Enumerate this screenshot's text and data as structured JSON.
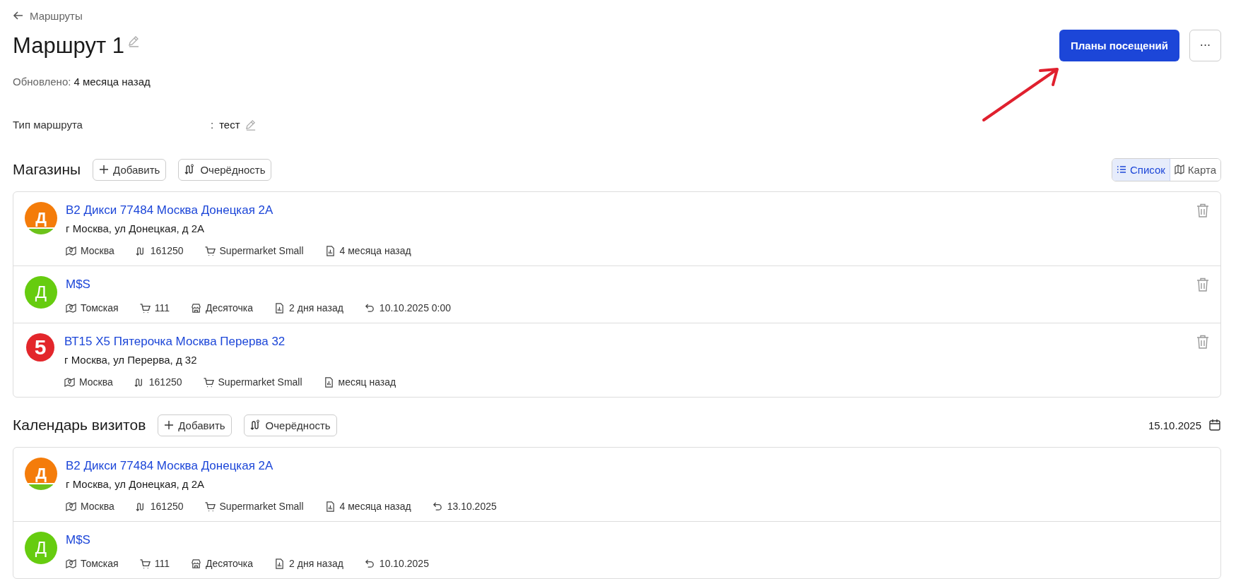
{
  "breadcrumb": {
    "label": "Маршруты"
  },
  "title": "Маршрут 1",
  "actions": {
    "primary": "Планы посещений",
    "more": "···"
  },
  "updated": {
    "label": "Обновлено:",
    "value": "4 месяца назад"
  },
  "route_type": {
    "label": "Тип маршрута",
    "separator": ":",
    "value": "тест"
  },
  "stores": {
    "title": "Магазины",
    "add": "Добавить",
    "order": "Очерёдность",
    "view_toggle": [
      {
        "label": "Список",
        "selected": true
      },
      {
        "label": "Карта",
        "selected": false
      }
    ],
    "items": [
      {
        "logo": {
          "kind": "dixy",
          "letter": "Д"
        },
        "name": "В2 Дикси 77484 Москва Донецкая 2А",
        "address": "г Москва, ул Донецкая, д 2А",
        "deletable": true,
        "meta": [
          {
            "kind": "region",
            "text": "Москва"
          },
          {
            "kind": "route",
            "text": "161250"
          },
          {
            "kind": "cart",
            "text": "Supermarket Small"
          },
          {
            "kind": "report",
            "text": "4 месяца назад"
          }
        ]
      },
      {
        "logo": {
          "kind": "circle",
          "letter": "Д"
        },
        "name": "M$S",
        "deletable": true,
        "meta": [
          {
            "kind": "region",
            "text": "Томская"
          },
          {
            "kind": "cart",
            "text": "111"
          },
          {
            "kind": "store",
            "text": "Десяточка"
          },
          {
            "kind": "report",
            "text": "2 дня назад"
          },
          {
            "kind": "visit",
            "text": "10.10.2025 0:00"
          }
        ]
      },
      {
        "logo": {
          "kind": "five",
          "letter": "5"
        },
        "name": "ВТ15 Х5 Пятерочка Москва Перерва 32",
        "address": "г Москва, ул Перерва, д 32",
        "deletable": true,
        "meta": [
          {
            "kind": "region",
            "text": "Москва"
          },
          {
            "kind": "route",
            "text": "161250"
          },
          {
            "kind": "cart",
            "text": "Supermarket Small"
          },
          {
            "kind": "report",
            "text": "месяц назад"
          }
        ]
      }
    ]
  },
  "calendar": {
    "title": "Календарь визитов",
    "add": "Добавить",
    "order": "Очерёдность",
    "date": "15.10.2025",
    "items": [
      {
        "logo": {
          "kind": "dixy",
          "letter": "Д"
        },
        "name": "В2 Дикси 77484 Москва Донецкая 2А",
        "address": "г Москва, ул Донецкая, д 2А",
        "deletable": false,
        "meta": [
          {
            "kind": "region",
            "text": "Москва"
          },
          {
            "kind": "route",
            "text": "161250"
          },
          {
            "kind": "cart",
            "text": "Supermarket Small"
          },
          {
            "kind": "report",
            "text": "4 месяца назад"
          },
          {
            "kind": "visit",
            "text": "13.10.2025"
          }
        ]
      },
      {
        "logo": {
          "kind": "circle",
          "letter": "Д"
        },
        "name": "M$S",
        "deletable": false,
        "meta": [
          {
            "kind": "region",
            "text": "Томская"
          },
          {
            "kind": "cart",
            "text": "111"
          },
          {
            "kind": "store",
            "text": "Десяточка"
          },
          {
            "kind": "report",
            "text": "2 дня назад"
          },
          {
            "kind": "visit",
            "text": "10.10.2025"
          }
        ]
      }
    ]
  }
}
